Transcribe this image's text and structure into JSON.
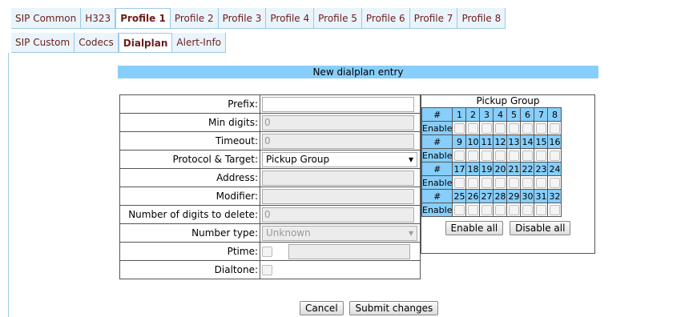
{
  "tabs_top": [
    "SIP Common",
    "H323",
    "Profile 1",
    "Profile 2",
    "Profile 3",
    "Profile 4",
    "Profile 5",
    "Profile 6",
    "Profile 7",
    "Profile 8"
  ],
  "tabs_top_active": 2,
  "tabs_sub": [
    "SIP Custom",
    "Codecs",
    "Dialplan",
    "Alert-Info"
  ],
  "tabs_sub_active": 2,
  "header": "New dialplan entry",
  "form": {
    "prefix_label": "Prefix:",
    "prefix_value": "",
    "min_digits_label": "Min digits:",
    "min_digits_value": "0",
    "timeout_label": "Timeout:",
    "timeout_value": "0",
    "protocol_label": "Protocol & Target:",
    "protocol_value": "Pickup Group",
    "address_label": "Address:",
    "address_value": "",
    "modifier_label": "Modifier:",
    "modifier_value": "",
    "digits_delete_label": "Number of digits to delete:",
    "digits_delete_value": "0",
    "number_type_label": "Number type:",
    "number_type_value": "Unknown",
    "ptime_label": "Ptime:",
    "dialtone_label": "Dialtone:"
  },
  "pickup": {
    "title": "Pickup Group",
    "hash": "#",
    "enable": "Enable",
    "rows": [
      [
        1,
        2,
        3,
        4,
        5,
        6,
        7,
        8
      ],
      [
        9,
        10,
        11,
        12,
        13,
        14,
        15,
        16
      ],
      [
        17,
        18,
        19,
        20,
        21,
        22,
        23,
        24
      ],
      [
        25,
        26,
        27,
        28,
        29,
        30,
        31,
        32
      ]
    ],
    "enable_all": "Enable all",
    "disable_all": "Disable all"
  },
  "buttons": {
    "cancel": "Cancel",
    "submit": "Submit changes"
  }
}
